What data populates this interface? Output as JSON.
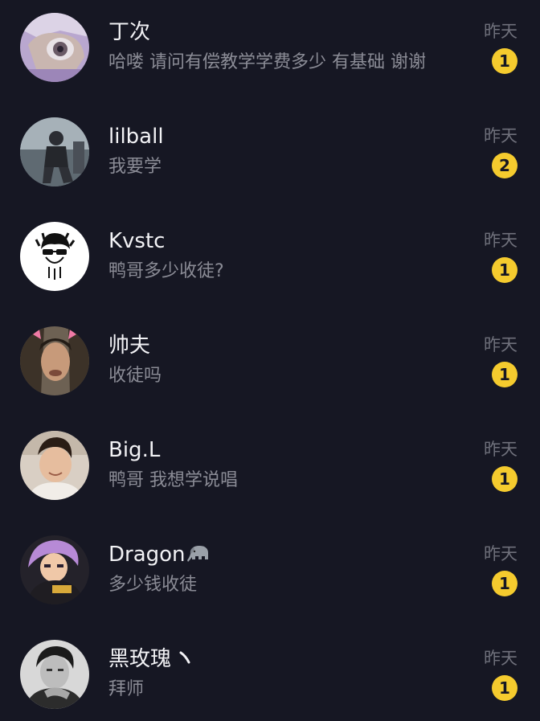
{
  "conversations": [
    {
      "name": "丁次",
      "message": "哈喽 请问有偿教学学费多少 有基础 谢谢",
      "time": "昨天",
      "unread": "1"
    },
    {
      "name": "lilball",
      "message": "我要学",
      "time": "昨天",
      "unread": "2"
    },
    {
      "name": "Kvstc",
      "message": "鸭哥多少收徒?",
      "time": "昨天",
      "unread": "1"
    },
    {
      "name": "帅夫",
      "message": "收徒吗",
      "time": "昨天",
      "unread": "1"
    },
    {
      "name": "Big.L",
      "message": "鸭哥 我想学说唱",
      "time": "昨天",
      "unread": "1"
    },
    {
      "name": "Dragon",
      "name_emoji": "elephant-icon",
      "message": "多少钱收徒",
      "time": "昨天",
      "unread": "1"
    },
    {
      "name": "黑玫瑰",
      "name_suffix_icon": "tick-mark-icon",
      "message": "拜师",
      "time": "昨天",
      "unread": "1"
    }
  ],
  "colors": {
    "background": "#161723",
    "badge": "#f5cb2e",
    "name": "#f2f2f5",
    "message": "#8b8c96",
    "time": "#6f707b"
  }
}
